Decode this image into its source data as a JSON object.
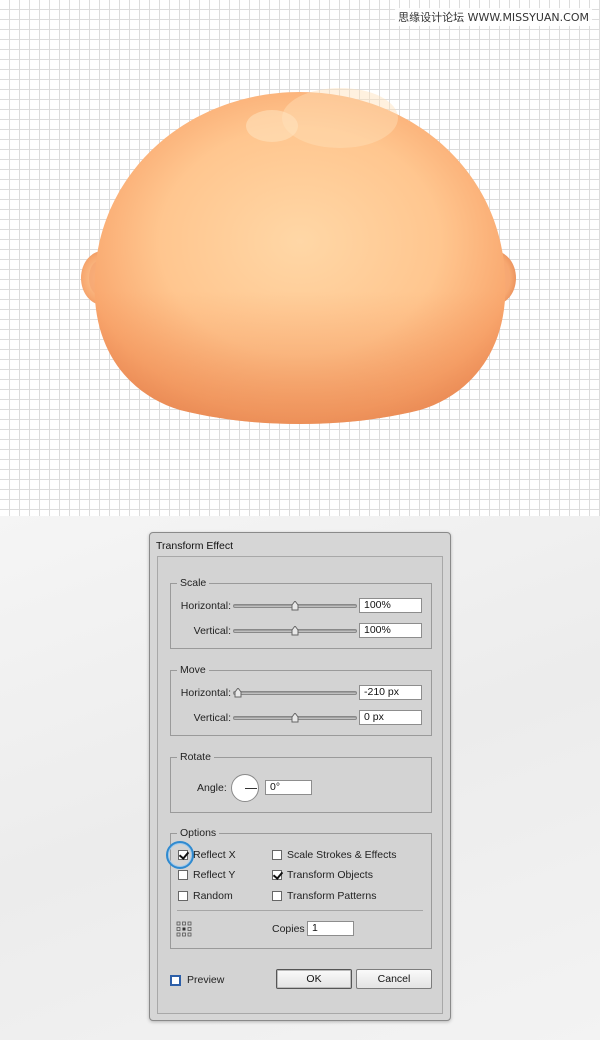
{
  "watermark": "思缘设计论坛 WWW.MISSYUAN.COM",
  "dialog": {
    "title": "Transform Effect",
    "scale": {
      "label": "Scale",
      "horizontal_label": "Horizontal:",
      "horizontal_value": "100%",
      "horizontal_slider_fraction": 0.5,
      "vertical_label": "Vertical:",
      "vertical_value": "100%",
      "vertical_slider_fraction": 0.5
    },
    "move": {
      "label": "Move",
      "horizontal_label": "Horizontal:",
      "horizontal_value": "-210 px",
      "horizontal_slider_fraction": 0.0,
      "vertical_label": "Vertical:",
      "vertical_value": "0 px",
      "vertical_slider_fraction": 0.5
    },
    "rotate": {
      "label": "Rotate",
      "angle_label": "Angle:",
      "angle_value": "0°"
    },
    "options": {
      "label": "Options",
      "reflect_x": {
        "label": "Reflect X",
        "checked": true
      },
      "reflect_y": {
        "label": "Reflect Y",
        "checked": false
      },
      "random": {
        "label": "Random",
        "checked": false
      },
      "scale_strokes": {
        "label": "Scale Strokes & Effects",
        "checked": false
      },
      "transform_objects": {
        "label": "Transform Objects",
        "checked": true
      },
      "transform_patterns": {
        "label": "Transform Patterns",
        "checked": false
      },
      "copies_label": "Copies",
      "copies_value": "1"
    },
    "preview_label": "Preview",
    "ok_label": "OK",
    "cancel_label": "Cancel"
  },
  "colors": {
    "head_light": "#ffd39f",
    "head_mid": "#fbb47d",
    "head_shadow": "#e88a55",
    "highlight_ring": "#2f8ad0",
    "preview_checkbox": "#2d5fa8"
  }
}
